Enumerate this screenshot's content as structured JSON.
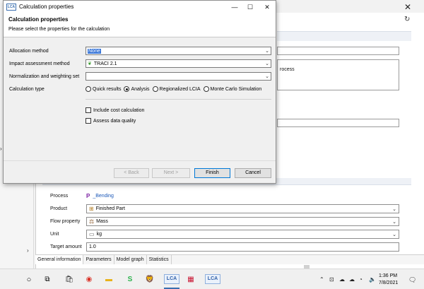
{
  "background": {
    "process_desc_text": "rocess",
    "quant_ref": {
      "process_label": "Process",
      "process_value": "_Bending",
      "product_label": "Product",
      "product_value": "Finished Part",
      "flow_property_label": "Flow property",
      "flow_property_value": "Mass",
      "unit_label": "Unit",
      "unit_value": "kg",
      "target_amount_label": "Target amount",
      "target_amount_value": "1.0"
    },
    "tabs": [
      "General information",
      "Parameters",
      "Model graph",
      "Statistics"
    ]
  },
  "dialog": {
    "app_icon_text": "LCA",
    "title": "Calculation properties",
    "heading": "Calculation properties",
    "subtitle": "Please select the properties for the calculation",
    "allocation_label": "Allocation method",
    "allocation_value": "None",
    "impact_label": "Impact assessment method",
    "impact_value": "TRACI 2.1",
    "normalization_label": "Normalization and weighting set",
    "normalization_value": "",
    "calc_type_label": "Calculation type",
    "calc_types": [
      "Quick results",
      "Analysis",
      "Regionalized LCIA",
      "Monte Carlo Simulation"
    ],
    "calc_type_selected": "Analysis",
    "include_cost_label": "Include cost calculation",
    "include_cost_checked": false,
    "assess_quality_label": "Assess data quality",
    "assess_quality_checked": false,
    "buttons": {
      "back": "< Back",
      "next": "Next >",
      "finish": "Finish",
      "cancel": "Cancel"
    }
  },
  "taskbar": {
    "lca_label": "LCA",
    "time": "1:36 PM",
    "date": "7/8/2021"
  }
}
